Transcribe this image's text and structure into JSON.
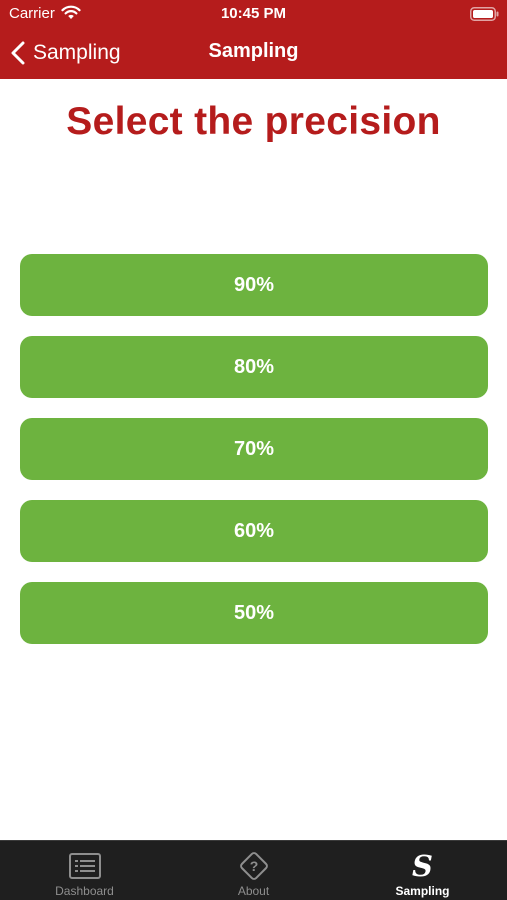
{
  "status_bar": {
    "carrier": "Carrier",
    "time": "10:45 PM"
  },
  "nav": {
    "back_label": "Sampling",
    "title": "Sampling"
  },
  "main": {
    "title": "Select the precision",
    "options": [
      "90%",
      "80%",
      "70%",
      "60%",
      "50%"
    ]
  },
  "tabs": [
    {
      "label": "Dashboard",
      "icon": "dashboard-icon",
      "active": false
    },
    {
      "label": "About",
      "icon": "about-icon",
      "active": false
    },
    {
      "label": "Sampling",
      "icon": "sampling-s-icon",
      "active": true,
      "glyph": "S"
    }
  ],
  "colors": {
    "brand_red": "#b51c1c",
    "option_green": "#6db33f",
    "tab_bar_bg": "#1f1f1f"
  }
}
